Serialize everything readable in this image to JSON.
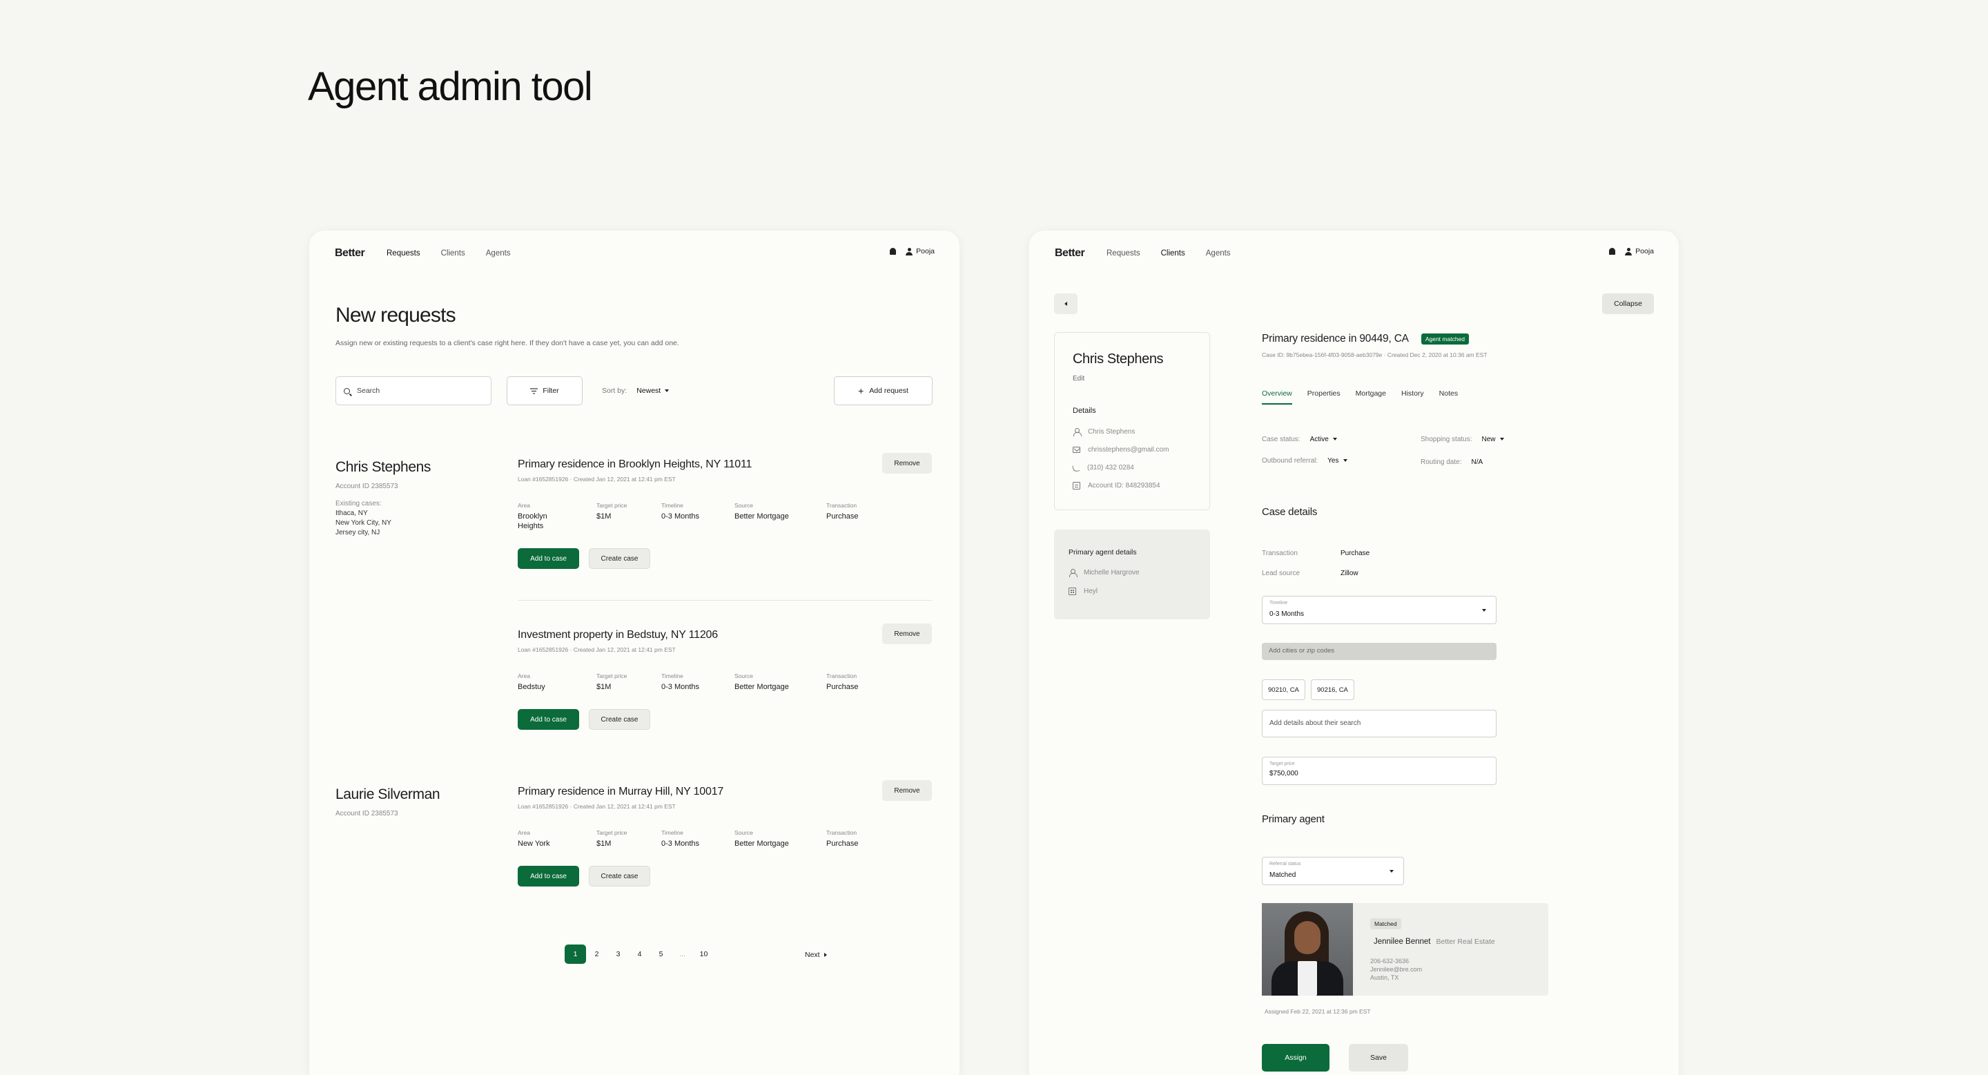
{
  "page_title": "Agent admin tool",
  "left": {
    "nav": {
      "logo": "Better",
      "links": [
        "Requests",
        "Clients",
        "Agents"
      ],
      "active_link": "Requests",
      "user": "Pooja"
    },
    "heading": "New requests",
    "subheading": "Assign new or existing requests to a client's case right here. If they don't have a case yet, you can add one.",
    "search_placeholder": "Search",
    "filter_label": "Filter",
    "sort_label": "Sort by:",
    "sort_value": "Newest",
    "add_request_label": "Add request",
    "clients": [
      {
        "name": "Chris Stephens",
        "account": "Account ID 2385573",
        "existing_label": "Existing cases:",
        "existing_cases": [
          "Ithaca, NY",
          "New York City, NY",
          "Jersey city, NJ"
        ]
      },
      {
        "name": "Laurie Silverman",
        "account": "Account ID 2385573"
      }
    ],
    "field_labels": {
      "area": "Area",
      "target_price": "Target price",
      "timeline": "Timeline",
      "source": "Source",
      "transaction": "Transaction"
    },
    "requests": [
      {
        "title": "Primary residence in Brooklyn Heights, NY 11011",
        "meta": "Loan #1652851926 · Created Jan 12, 2021 at 12:41 pm EST",
        "area": "Brooklyn Heights",
        "target_price": "$1M",
        "timeline": "0-3 Months",
        "source": "Better Mortgage",
        "transaction": "Purchase"
      },
      {
        "title": "Investment property in Bedstuy, NY 11206",
        "meta": "Loan #1652851926 · Created Jan 12, 2021 at 12:41 pm EST",
        "area": "Bedstuy",
        "target_price": "$1M",
        "timeline": "0-3 Months",
        "source": "Better Mortgage",
        "transaction": "Purchase"
      },
      {
        "title": "Primary residence in Murray Hill, NY 10017",
        "meta": "Loan #1652851926 · Created Jan 12, 2021 at 12:41 pm EST",
        "area": "New York",
        "target_price": "$1M",
        "timeline": "0-3 Months",
        "source": "Better Mortgage",
        "transaction": "Purchase"
      }
    ],
    "buttons": {
      "add_to_case": "Add to case",
      "create_case": "Create case",
      "remove": "Remove"
    },
    "pagination": {
      "pages": [
        "1",
        "2",
        "3",
        "4",
        "5",
        "...",
        "10"
      ],
      "current": "1",
      "next": "Next"
    }
  },
  "right": {
    "nav": {
      "logo": "Better",
      "links": [
        "Requests",
        "Clients",
        "Agents"
      ],
      "active_link": "Clients",
      "user": "Pooja"
    },
    "collapse_label": "Collapse",
    "client": {
      "name": "Chris Stephens",
      "edit": "Edit",
      "details_title": "Details",
      "contact_name": "Chris Stephens",
      "email": "chrisstephens@gmail.com",
      "phone": "(310) 432 0284",
      "account_id": "Account ID: 848293854"
    },
    "primary_agent_box": {
      "title": "Primary agent details",
      "agent": "Michelle Hargrove",
      "brokerage": "Heyl"
    },
    "case": {
      "title": "Primary residence in 90449, CA",
      "badge": "Agent matched",
      "meta": "Case ID: 9b75ebea-156f-4f03-9058-aeb3079e · Created Dec 2, 2020 at 10:36 am EST",
      "tabs": [
        "Overview",
        "Properties",
        "Mortgage",
        "History",
        "Notes"
      ],
      "active_tab": "Overview",
      "case_status_label": "Case status:",
      "case_status": "Active",
      "shopping_status_label": "Shopping status:",
      "shopping_status": "New",
      "outbound_label": "Outbound referral:",
      "outbound": "Yes",
      "routing_label": "Routing date:",
      "routing": "N/A"
    },
    "case_details": {
      "title": "Case details",
      "transaction_label": "Transaction",
      "transaction": "Purchase",
      "lead_source_label": "Lead source",
      "lead_source": "Zillow",
      "timeline_label": "Timeline",
      "timeline": "0-3 Months",
      "cities_placeholder": "Add cities or zip codes",
      "chips": [
        "90210, CA",
        "90216, CA"
      ],
      "details_placeholder": "Add details about their search",
      "target_price_label": "Target price",
      "target_price": "$750,000"
    },
    "primary_agent": {
      "title": "Primary agent",
      "referral_label": "Referral status",
      "referral_value": "Matched",
      "badge": "Matched",
      "name": "Jennilee Bennet",
      "firm": "Better Real Estate",
      "phone": "206-632-3636",
      "email": "Jennilee@bre.com",
      "location": "Austin, TX",
      "assigned": "Assigned Feb 22, 2021 at 12:36 pm EST"
    },
    "buttons": {
      "assign": "Assign",
      "save": "Save"
    }
  }
}
